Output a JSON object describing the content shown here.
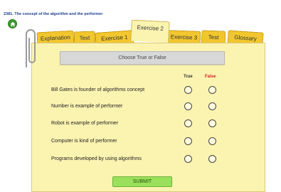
{
  "lesson": {
    "title": "2381. The concept of the algorithm and the performer"
  },
  "tabs": [
    {
      "label": "Explanation"
    },
    {
      "label": "Text"
    },
    {
      "label": "Exercise 1"
    },
    {
      "label": "Exercise 2",
      "active": true
    },
    {
      "label": "Exercise 3"
    },
    {
      "label": "Test"
    },
    {
      "label": "Glossary"
    }
  ],
  "exercise": {
    "instruction": "Choose True or False",
    "true_label": "True",
    "false_label": "False",
    "statements": [
      {
        "text": "Bill Gates is founder of algorithms concept"
      },
      {
        "text": "Number is example of performer"
      },
      {
        "text": "Robot is example of performer"
      },
      {
        "text": "Computer is kind of performer"
      },
      {
        "text": "Programs developed by using algorithms"
      }
    ],
    "submit_label": "SUBMIT"
  },
  "icons": {
    "home": "home-icon",
    "clip": "paperclip-icon"
  },
  "colors": {
    "tab": "#f2c72e",
    "panel": "#fbf3b0",
    "false_header": "#d42020",
    "submit": "#9be05a",
    "title": "#1f3f8f"
  }
}
